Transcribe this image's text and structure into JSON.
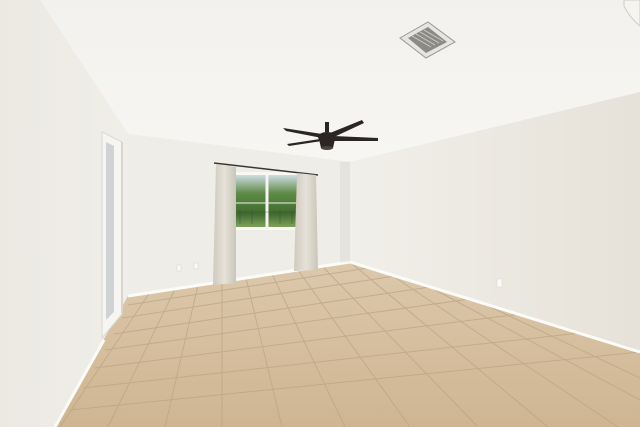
{
  "scene": {
    "description_visible_text": "",
    "colors": {
      "ceiling": "#f4f3f0",
      "wall_left": "#ecebe4",
      "wall_back": "#efede6",
      "wall_right": "#eae7df",
      "floor_light": "#d9c3a6",
      "floor_dark": "#c7ad8b",
      "grout": "#b59c7c",
      "baseboard": "#fbfbf8",
      "fan": "#2b2623",
      "curtain": "#dcd7cc",
      "window_trees": "#4f7d3a",
      "window_sky": "#c9d8df"
    },
    "icons": {
      "fan": "ceiling-fan-icon",
      "vent": "air-vent-icon"
    }
  }
}
